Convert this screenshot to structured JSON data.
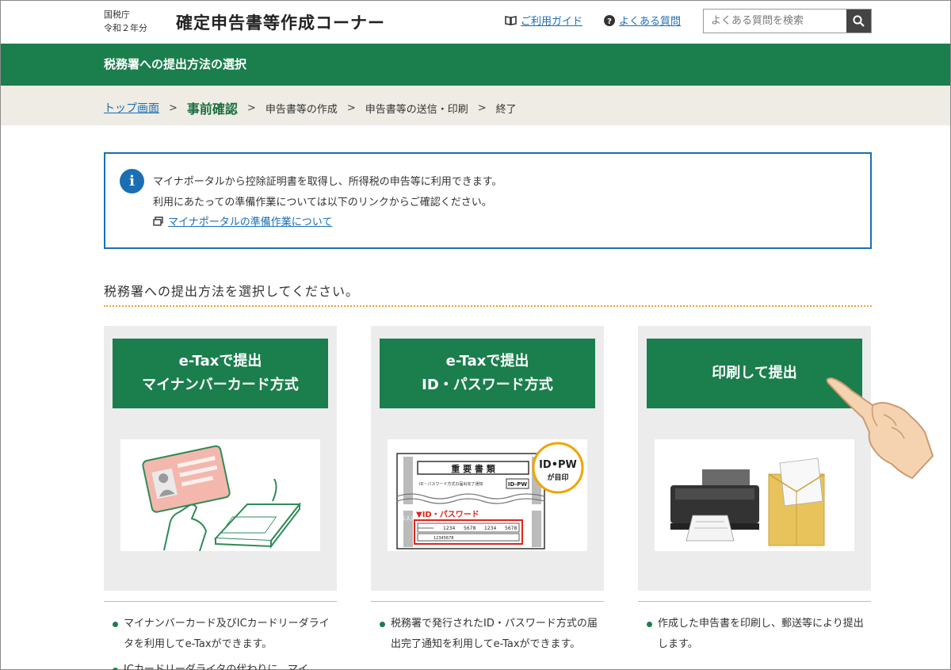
{
  "header": {
    "agency_line1": "国税庁",
    "agency_line2": "令和２年分",
    "site_title": "確定申告書等作成コーナー",
    "guide_link": "ご利用ガイド",
    "faq_link": "よくある質問",
    "search_placeholder": "よくある質問を検索"
  },
  "page_heading": "税務署への提出方法の選択",
  "breadcrumb": {
    "top": "トップ画面",
    "step1": "事前確認",
    "step2": "申告書等の作成",
    "step3": "申告書等の送信・印刷",
    "step4": "終了"
  },
  "info": {
    "line1": "マイナポータルから控除証明書を取得し、所得税の申告等に利用できます。",
    "line2": "利用にあたっての準備作業については以下のリンクからご確認ください。",
    "link": "マイナポータルの準備作業について"
  },
  "section_heading": "税務署への提出方法を選択してください。",
  "cards": [
    {
      "button_line1": "e-Taxで提出",
      "button_line2": "マイナンバーカード方式",
      "bullets": [
        "マイナンバーカード及びICカードリーダライタを利用してe-Taxができます。",
        "ICカードリーダライタの代わりに、マイ"
      ]
    },
    {
      "button_line1": "e-Taxで提出",
      "button_line2": "ID・パスワード方式",
      "bullets": [
        "税務署で発行されたID・パスワード方式の届出完了通知を利用してe-Taxができます。"
      ],
      "img_text": {
        "doc_title": "重 要 書 類",
        "doc_sub": "ID・パスワード方式の届出完了通知",
        "doc_tag": "ID-PW",
        "badge_top": "ID•PW",
        "badge_bottom": "が目印",
        "side_label": "本人用",
        "id_header": "▼ID・パスワード",
        "cells": [
          "1234",
          "5678",
          "1234",
          "5678"
        ],
        "id_num": "12345678"
      }
    },
    {
      "button_line1": "印刷して提出",
      "bullets": [
        "作成した申告書を印刷し、郵送等により提出します。"
      ]
    }
  ],
  "colors": {
    "brand_green": "#1b7e4d",
    "link_blue": "#1a6fb4",
    "breadcrumb_bg": "#eeece4",
    "dotted_accent": "#e8a33a"
  }
}
